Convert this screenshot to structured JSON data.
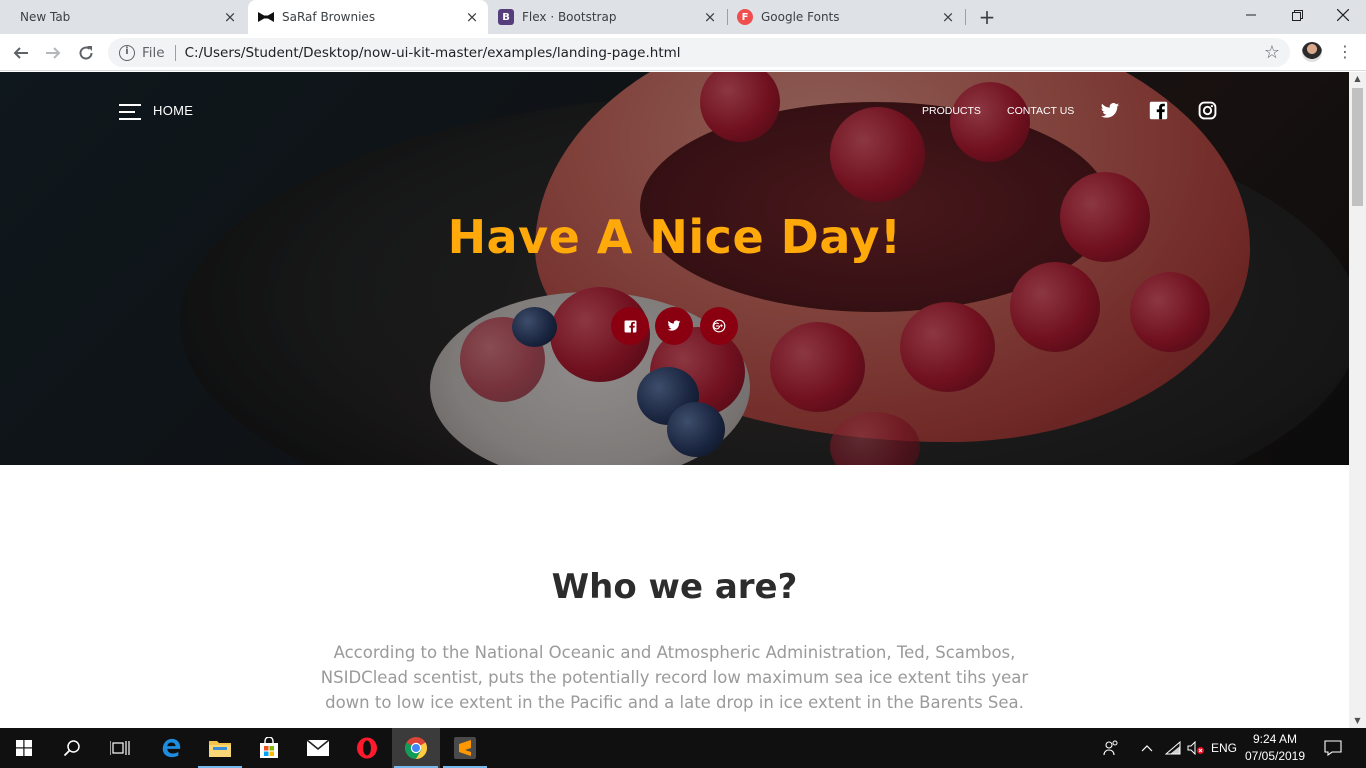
{
  "browser": {
    "tabs": [
      {
        "title": "New Tab",
        "active": false
      },
      {
        "title": "SaRaf Brownies",
        "active": true
      },
      {
        "title": "Flex · Bootstrap",
        "active": false,
        "favicon_letter": "B"
      },
      {
        "title": "Google Fonts",
        "active": false,
        "favicon_letter": "F"
      }
    ],
    "address": {
      "scheme_label": "File",
      "url": "C:/Users/Student/Desktop/now-ui-kit-master/examples/landing-page.html"
    },
    "icons": [
      "back-icon",
      "forward-icon",
      "reload-icon",
      "info-icon",
      "star-icon",
      "profile-avatar",
      "menu-icon",
      "new-tab-icon",
      "minimize-icon",
      "maximize-icon",
      "close-icon"
    ]
  },
  "page": {
    "nav": {
      "home_label": "HOME",
      "links": [
        "PRODUCTS",
        "CONTACT US"
      ],
      "social_icons": [
        "twitter-icon",
        "facebook-icon",
        "instagram-icon"
      ]
    },
    "hero": {
      "title": "Have A Nice Day!",
      "title_color": "#ffa90a",
      "buttons": [
        "facebook-icon",
        "twitter-icon",
        "google-plus-icon"
      ],
      "button_color": "#8a0010"
    },
    "about": {
      "title": "Who we are?",
      "text": "According to the National Oceanic and Atmospheric Administration, Ted, Scambos, NSIDClead scentist, puts the potentially record low maximum sea ice extent tihs year down to low ice extent in the Pacific and a late drop in ice extent in the Barents Sea."
    }
  },
  "taskbar": {
    "apps": [
      "windows-start-icon",
      "search-icon",
      "task-view-icon",
      "edge-icon",
      "file-explorer-icon",
      "store-icon",
      "mail-icon",
      "opera-icon",
      "chrome-icon",
      "sublime-text-icon"
    ],
    "active_apps": [
      "chrome-icon",
      "sublime-text-icon"
    ],
    "tray": {
      "language": "ENG",
      "time": "9:24 AM",
      "date": "07/05/2019"
    }
  }
}
